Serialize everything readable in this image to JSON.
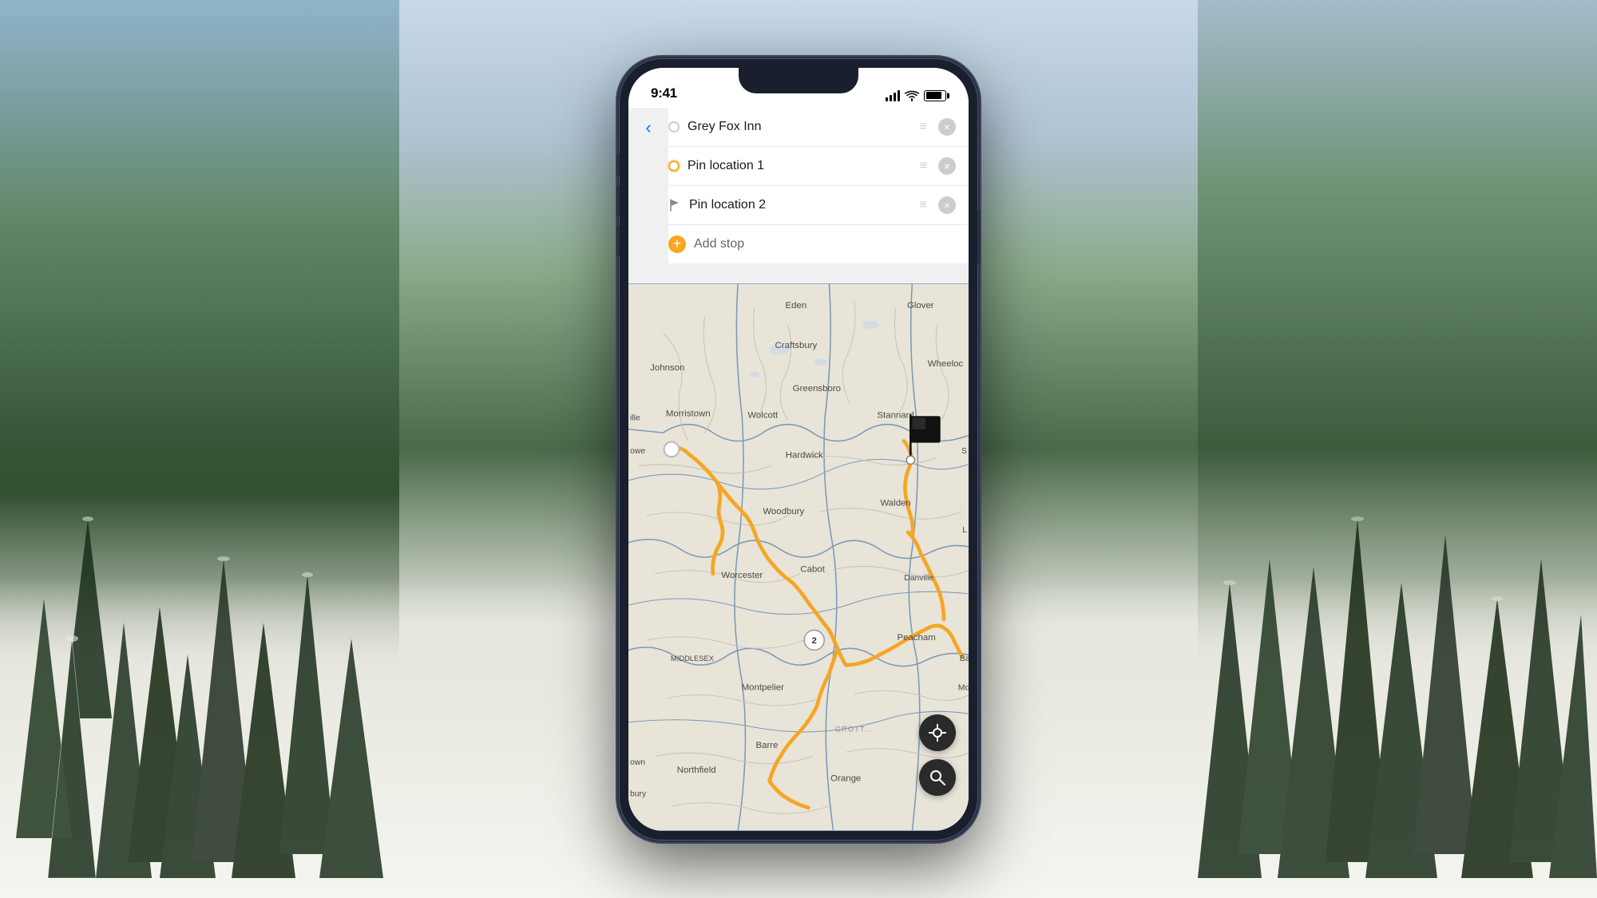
{
  "background": {
    "description": "Snowy mountain forest scene"
  },
  "phone": {
    "status_bar": {
      "time": "9:41",
      "signal_label": "signal",
      "wifi_label": "wifi",
      "battery_label": "battery"
    },
    "route_panel": {
      "back_button_label": "‹",
      "stops": [
        {
          "id": "stop-1",
          "name": "Grey Fox Inn",
          "icon_type": "circle",
          "icon_color": "grey"
        },
        {
          "id": "stop-2",
          "name": "Pin location 1",
          "icon_type": "circle",
          "icon_color": "yellow"
        },
        {
          "id": "stop-3",
          "name": "Pin location 2",
          "icon_type": "flag",
          "icon_color": "grey"
        }
      ],
      "add_stop_label": "Add stop",
      "add_stop_icon": "+"
    },
    "map": {
      "towns": [
        "Eden",
        "Glover",
        "Johnson",
        "Craftsbury",
        "Morristown",
        "Greensboro",
        "Wheeloc",
        "Wolcott",
        "Stannard",
        "Hardwick",
        "Woodbury",
        "Walden",
        "Worcester",
        "Cabot",
        "Danville",
        "Peacham",
        "Bar",
        "MIDDLESEX",
        "Montpelier",
        "Mon",
        "Barre",
        "Northfield",
        "Orange",
        "own",
        "bury",
        "ille",
        "S"
      ],
      "crosshair_button_label": "⊕",
      "search_button_label": "🔍"
    }
  }
}
